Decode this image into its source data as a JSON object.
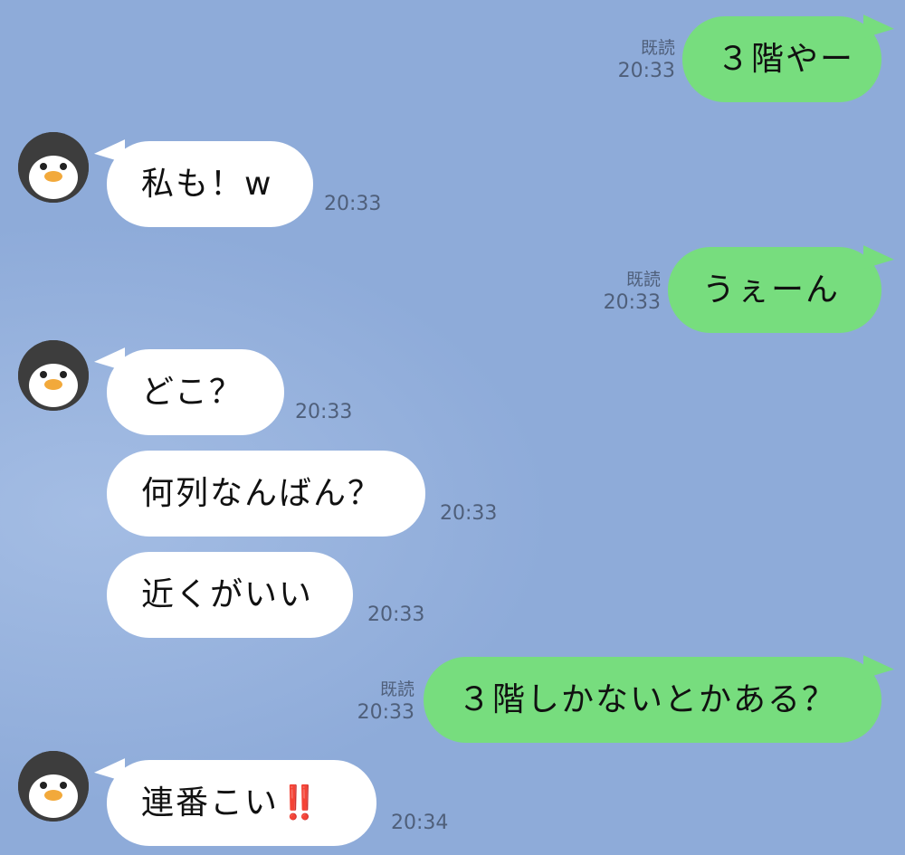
{
  "messages": [
    {
      "side": "out",
      "text": "３階やー",
      "read": "既読",
      "time": "20:33"
    },
    {
      "side": "in",
      "text": "私も！w",
      "time": "20:33"
    },
    {
      "side": "out",
      "text": "うぇーん",
      "read": "既読",
      "time": "20:33"
    },
    {
      "side": "in",
      "text": "どこ？",
      "time": "20:33"
    },
    {
      "side": "in",
      "text": "何列なんばん？",
      "time": "20:33"
    },
    {
      "side": "in",
      "text": "近くがいい",
      "time": "20:33"
    },
    {
      "side": "out",
      "text": "３階しかないとかある？",
      "read": "既読",
      "time": "20:33"
    },
    {
      "side": "in",
      "text": "連番こい",
      "emoji": "‼️",
      "time": "20:34"
    }
  ],
  "avatar_icon": "penguin-icon",
  "colors": {
    "background": "#8eabd9",
    "outgoing_bubble": "#77dd7e",
    "incoming_bubble": "#ffffff",
    "meta_text": "#4f5f7a"
  }
}
